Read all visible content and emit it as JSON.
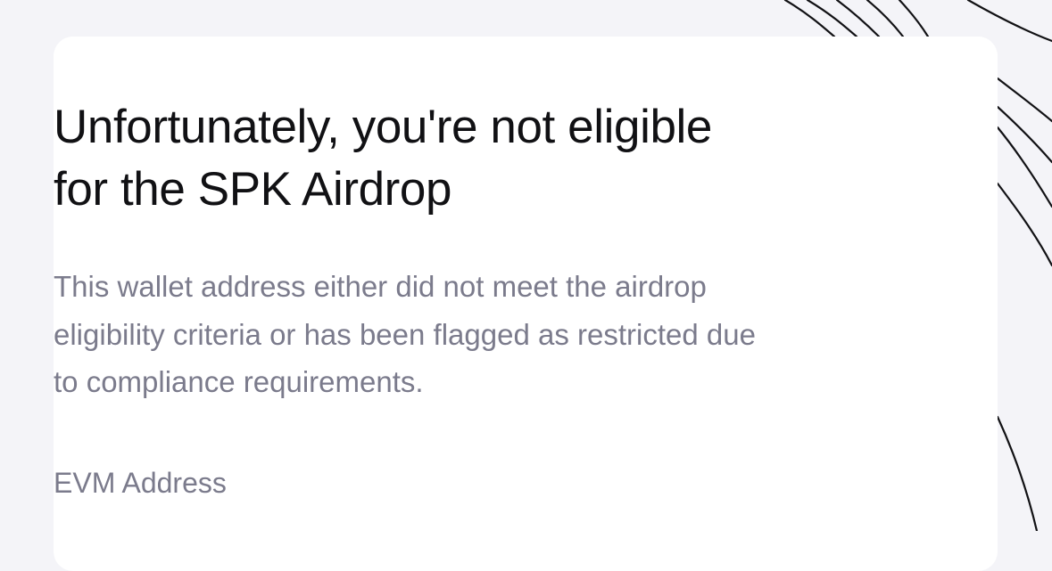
{
  "dialog": {
    "title_lines": [
      "Unfortunately, you're not eligible",
      "for the SPK Airdrop"
    ],
    "description_lines": [
      "This wallet address either did not meet the airdrop",
      "eligibility criteria or has been flagged as restricted due",
      "to compliance requirements."
    ],
    "field_label": "EVM Address"
  },
  "colors": {
    "page_background": "#f4f4f8",
    "card_background": "#ffffff",
    "title_text": "#111114",
    "secondary_text": "#7b7b8c",
    "decorative_lines": "#111114"
  }
}
